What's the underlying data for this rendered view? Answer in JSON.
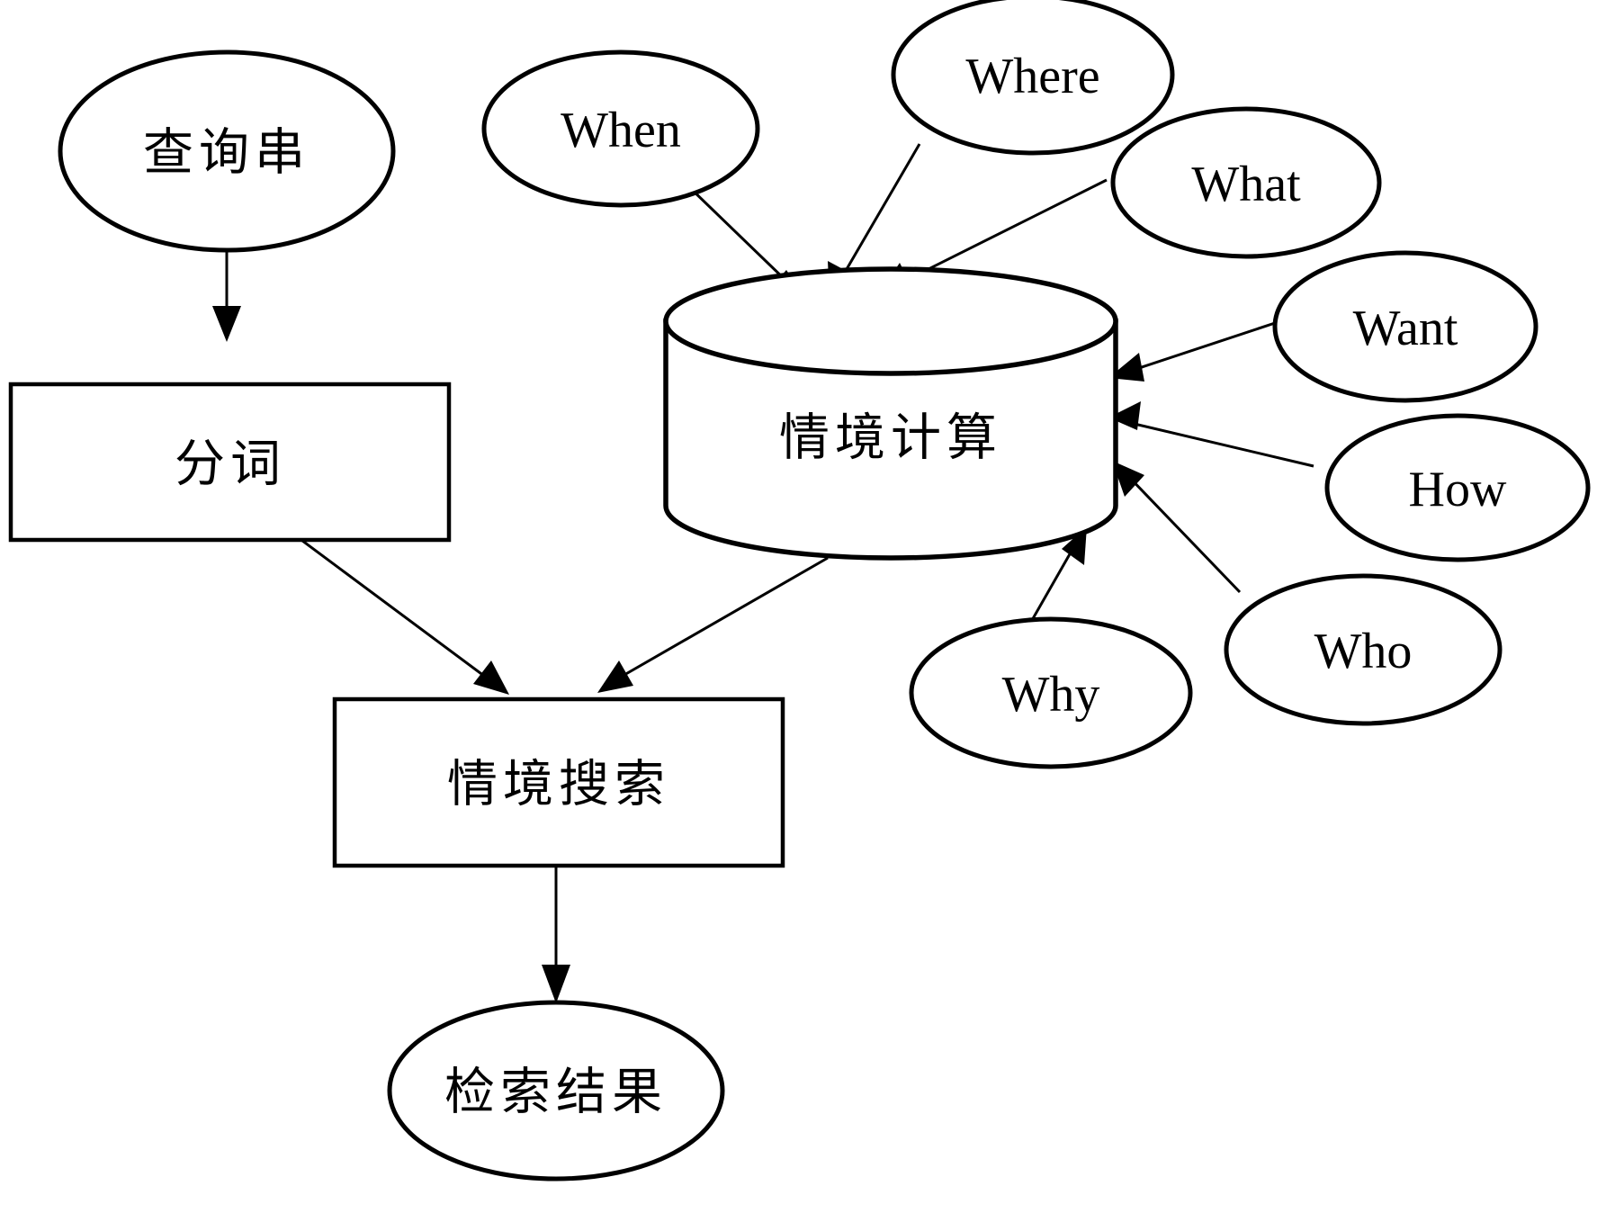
{
  "diagram": {
    "title": "",
    "background_color": "#ffffff",
    "stroke_color": "#000000",
    "nodes": {
      "query_string": {
        "label": "查询串",
        "shape": "ellipse"
      },
      "word_segmentation": {
        "label": "分词",
        "shape": "rectangle"
      },
      "context_computing": {
        "label": "情境计算",
        "shape": "cylinder"
      },
      "context_search": {
        "label": "情境搜索",
        "shape": "rectangle"
      },
      "search_result": {
        "label": "检索结果",
        "shape": "ellipse"
      },
      "when": {
        "label": "When",
        "shape": "ellipse"
      },
      "where": {
        "label": "Where",
        "shape": "ellipse"
      },
      "what": {
        "label": "What",
        "shape": "ellipse"
      },
      "want": {
        "label": "Want",
        "shape": "ellipse"
      },
      "how": {
        "label": "How",
        "shape": "ellipse"
      },
      "who": {
        "label": "Who",
        "shape": "ellipse"
      },
      "why": {
        "label": "Why",
        "shape": "ellipse"
      }
    },
    "edges": [
      {
        "from": "query_string",
        "to": "word_segmentation"
      },
      {
        "from": "word_segmentation",
        "to": "context_search"
      },
      {
        "from": "when",
        "to": "context_computing"
      },
      {
        "from": "where",
        "to": "context_computing"
      },
      {
        "from": "what",
        "to": "context_computing"
      },
      {
        "from": "want",
        "to": "context_computing"
      },
      {
        "from": "how",
        "to": "context_computing"
      },
      {
        "from": "who",
        "to": "context_computing"
      },
      {
        "from": "why",
        "to": "context_computing"
      },
      {
        "from": "context_computing",
        "to": "context_search"
      },
      {
        "from": "context_search",
        "to": "search_result"
      }
    ]
  }
}
